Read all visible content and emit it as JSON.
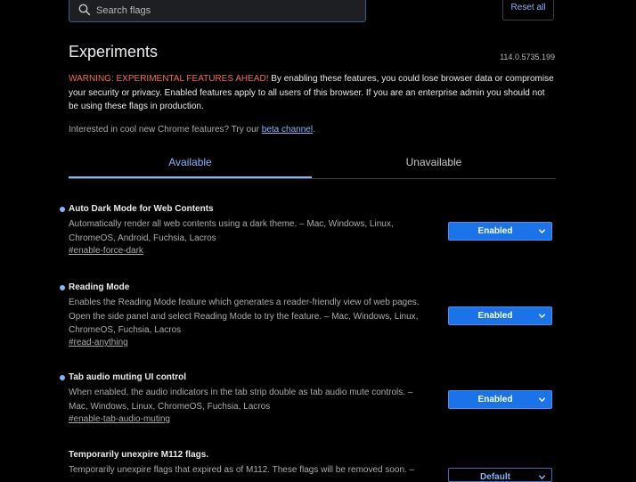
{
  "search": {
    "placeholder": "Search flags"
  },
  "reset_label": "Reset all",
  "page_title": "Experiments",
  "version": "114.0.5735.199",
  "warning": {
    "label": "WARNING: EXPERIMENTAL FEATURES AHEAD!",
    "text": " By enabling these features, you could lose browser data or compromise your security or privacy. Enabled features apply to all users of this browser. If you are an enterprise admin you should not be using these flags in production."
  },
  "interest": {
    "text": "Interested in cool new Chrome features? Try our ",
    "link": "beta channel",
    "suffix": "."
  },
  "tabs": [
    {
      "label": "Available"
    },
    {
      "label": "Unavailable"
    }
  ],
  "flags": [
    {
      "title": "Auto Dark Mode for Web Contents",
      "description": "Automatically render all web contents using a dark theme. – Mac, Windows, Linux, ChromeOS, Android, Fuchsia, Lacros",
      "link": "#enable-force-dark",
      "value": "Enabled"
    },
    {
      "title": "Reading Mode",
      "description": "Enables the Reading Mode feature which generates a reader-friendly view of web pages. Open the side panel and select Reading Mode to try the feature. – Mac, Windows, Linux, ChromeOS, Fuchsia, Lacros",
      "link": "#read-anything",
      "value": "Enabled"
    },
    {
      "title": "Tab audio muting UI control",
      "description": "When enabled, the audio indicators in the tab strip double as tab audio mute controls. – Mac, Windows, Linux, ChromeOS, Fuchsia, Lacros",
      "link": "#enable-tab-audio-muting",
      "value": "Enabled"
    },
    {
      "title": "Temporarily unexpire M112 flags.",
      "description": "Temporarily unexpire flags that expired as of M112. These flags will be removed soon. –",
      "value": "Default"
    }
  ],
  "colors": {
    "accent": "#8ab4f8",
    "warning": "#f26b5c",
    "enabled_select": "#1a73e8",
    "background": "#000000"
  }
}
